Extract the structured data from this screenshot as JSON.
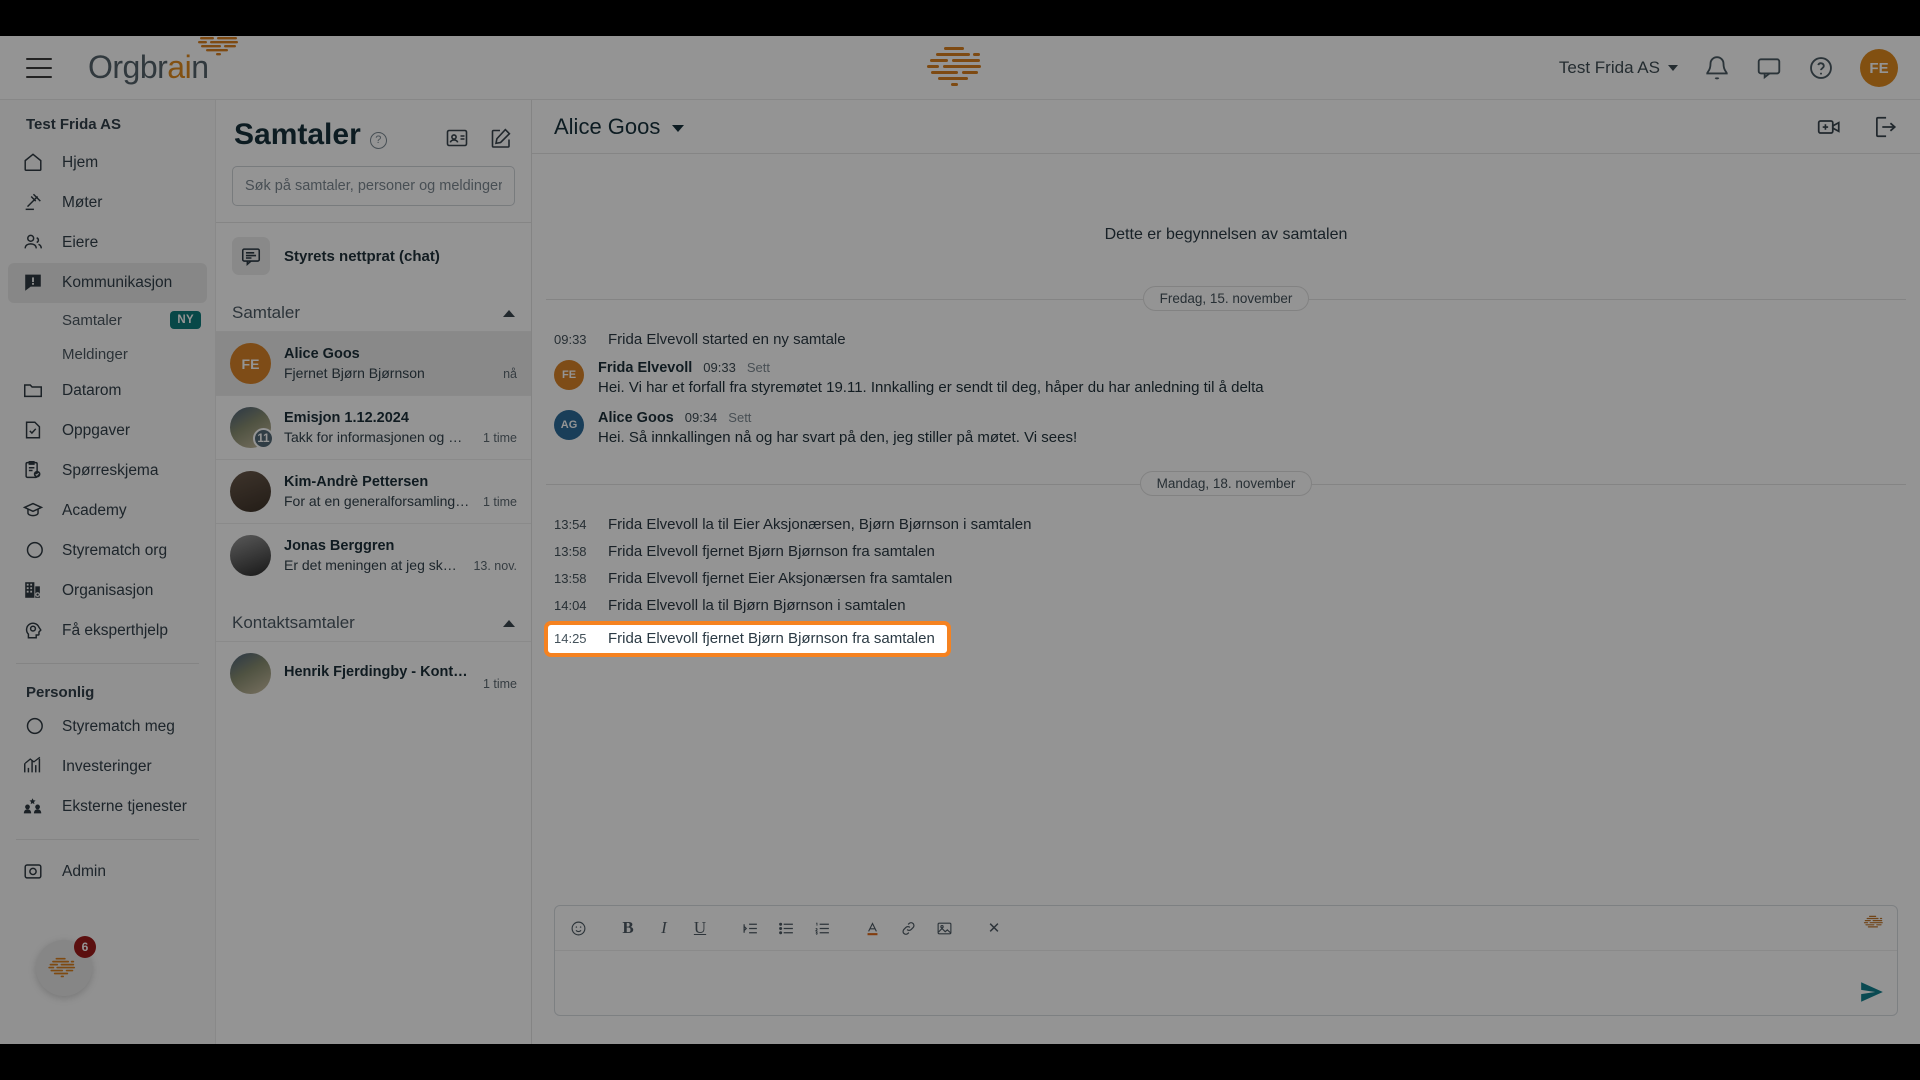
{
  "topbar": {
    "brand_prefix": "Orgbr",
    "brand_accent": "ai",
    "brand_suffix": "n",
    "org_name": "Test Frida AS",
    "avatar_initials": "FE",
    "icons": [
      "notifications-bell-icon",
      "chat-icon",
      "help-circle-icon"
    ]
  },
  "sidebar": {
    "org_label": "Test Frida AS",
    "items": [
      {
        "label": "Hjem",
        "icon": "home-icon"
      },
      {
        "label": "Møter",
        "icon": "gavel-icon"
      },
      {
        "label": "Eiere",
        "icon": "people-icon"
      },
      {
        "label": "Kommunikasjon",
        "icon": "chat-alert-icon",
        "active": true
      }
    ],
    "sub_items": [
      {
        "label": "Samtaler",
        "badge": "NY"
      },
      {
        "label": "Meldinger",
        "badge": ""
      }
    ],
    "items2": [
      {
        "label": "Datarom",
        "icon": "folder-icon"
      },
      {
        "label": "Oppgaver",
        "icon": "task-check-icon"
      },
      {
        "label": "Spørreskjema",
        "icon": "clipboard-check-icon"
      },
      {
        "label": "Academy",
        "icon": "graduation-cap-icon"
      },
      {
        "label": "Styrematch org",
        "icon": "venn-circles-icon"
      },
      {
        "label": "Organisasjon",
        "icon": "building-gear-icon"
      },
      {
        "label": "Få eksperthjelp",
        "icon": "head-gear-icon"
      }
    ],
    "personal_label": "Personlig",
    "personal_items": [
      {
        "label": "Styrematch meg",
        "icon": "venn-circles-icon"
      },
      {
        "label": "Investeringer",
        "icon": "chart-up-icon"
      },
      {
        "label": "Eksterne tjenester",
        "icon": "handshake-star-icon"
      }
    ],
    "admin_label": "Admin",
    "admin_icon": "shield-camera-icon",
    "chat_fab_badge": "6"
  },
  "conversation_list": {
    "title": "Samtaler",
    "help_icon": "help-circle-icon",
    "action_icons": [
      "contact-card-icon",
      "compose-icon"
    ],
    "search_placeholder": "Søk på samtaler, personer og meldinger",
    "search_value": "",
    "pinned": {
      "label": "Styrets nettprat (chat)",
      "icon": "chat-lines-icon"
    },
    "sections": [
      {
        "label": "Samtaler",
        "items": [
          {
            "name": "Alice Goos",
            "preview": "Fjernet Bjørn Bjørnson",
            "time": "nå",
            "initials": "FE",
            "color": "#d98328",
            "count": "",
            "selected": true
          },
          {
            "name": "Emisjon 1.12.2024",
            "preview": "Takk for informasjonen og den o…",
            "time": "1 time",
            "initials": "",
            "color": "#7e8b94",
            "count": "11",
            "selected": false
          },
          {
            "name": "Kim-Andrè Pettersen",
            "preview": "For at en generalforsamling (GF)…",
            "time": "1 time",
            "initials": "",
            "color": "#6b5a4c",
            "count": "",
            "selected": false
          },
          {
            "name": "Jonas Berggren",
            "preview": "Er det meningen at jeg skal delt…",
            "time": "13. nov.",
            "initials": "",
            "color": "#3b4148",
            "count": "",
            "selected": false
          }
        ]
      },
      {
        "label": "Kontaktsamtaler",
        "items": [
          {
            "name": "Henrik Fjerdingby - Kontakt styret",
            "preview": "",
            "time": "1 time",
            "initials": "",
            "color": "#7e8b94",
            "count": "",
            "selected": false
          }
        ]
      }
    ]
  },
  "chat": {
    "title": "Alice Goos",
    "header_icons": [
      "add-video-call-icon",
      "leave-conversation-icon"
    ],
    "begin_text": "Dette er begynnelsen av samtalen",
    "blocks": [
      {
        "type": "day",
        "label": "Fredag, 15. november"
      },
      {
        "type": "system",
        "time": "09:33",
        "text": "Frida Elvevoll started en ny samtale"
      },
      {
        "type": "message",
        "initials": "FE",
        "color": "#d98328",
        "name": "Frida Elvevoll",
        "time": "09:33",
        "seen": "Sett",
        "text": "Hei. Vi har et forfall fra styremøtet 19.11. Innkalling er sendt til deg, håper du har anledning til å delta"
      },
      {
        "type": "message",
        "initials": "AG",
        "color": "#2c6b99",
        "name": "Alice Goos",
        "time": "09:34",
        "seen": "Sett",
        "text": "Hei. Så innkallingen nå og har svart på den, jeg stiller på møtet. Vi sees!"
      },
      {
        "type": "day",
        "label": "Mandag, 18. november"
      },
      {
        "type": "system",
        "time": "13:54",
        "text": "Frida Elvevoll la til Eier Aksjonærsen, Bjørn Bjørnson i samtalen"
      },
      {
        "type": "system",
        "time": "13:58",
        "text": "Frida Elvevoll fjernet Bjørn Bjørnson fra samtalen"
      },
      {
        "type": "system",
        "time": "13:58",
        "text": "Frida Elvevoll fjernet Eier Aksjonærsen fra samtalen"
      },
      {
        "type": "system",
        "time": "14:04",
        "text": "Frida Elvevoll la til Bjørn Bjørnson i samtalen"
      },
      {
        "type": "system",
        "time": "14:25",
        "text": "Frida Elvevoll fjernet Bjørn Bjørnson fra samtalen",
        "highlighted": true
      }
    ]
  },
  "composer": {
    "value": "",
    "toolbar": [
      {
        "icon": "emoji-icon",
        "label": "☺"
      },
      {
        "icon": "bold-icon",
        "label": "B"
      },
      {
        "icon": "italic-icon",
        "label": "I"
      },
      {
        "icon": "underline-icon",
        "label": "U"
      },
      {
        "icon": "indent-icon",
        "label": ""
      },
      {
        "icon": "bullet-list-icon",
        "label": ""
      },
      {
        "icon": "numbered-list-icon",
        "label": ""
      },
      {
        "icon": "text-color-icon",
        "label": "A"
      },
      {
        "icon": "link-icon",
        "label": ""
      },
      {
        "icon": "image-icon",
        "label": ""
      },
      {
        "icon": "clear-format-icon",
        "label": "✕"
      }
    ],
    "send_icon": "send-icon",
    "brain_icon": "orgbrain-logo-icon"
  },
  "colors": {
    "accent_orange": "#e08b1e",
    "highlight_orange": "#f58220",
    "teal_badge": "#0f7d7d",
    "red_badge": "#9e1b1b",
    "dark_text": "#17313c"
  }
}
